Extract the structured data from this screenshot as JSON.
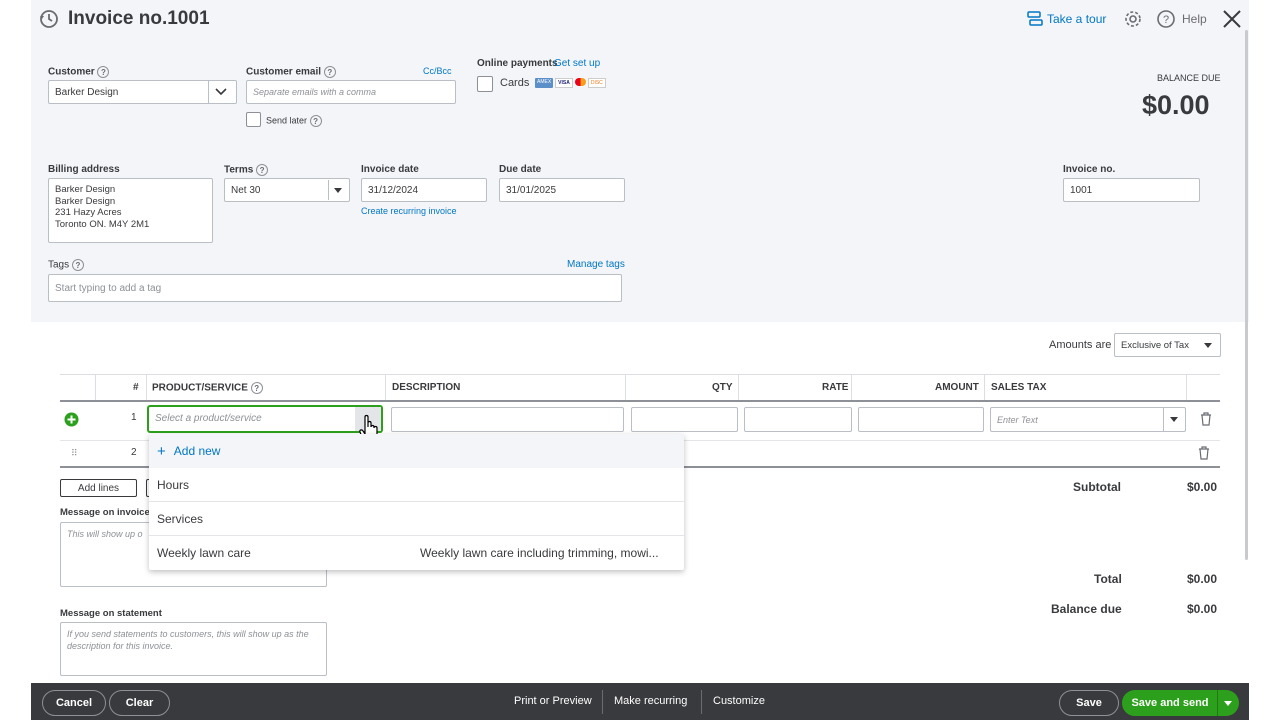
{
  "header": {
    "title": "Invoice no.1001",
    "take_tour": "Take a tour",
    "help": "Help"
  },
  "customer": {
    "label": "Customer",
    "value": "Barker Design",
    "email_label": "Customer email",
    "email_placeholder": "Separate emails with a comma",
    "cc_bcc": "Cc/Bcc",
    "send_later": "Send later"
  },
  "payments": {
    "label": "Online payments",
    "get_setup": "Get set up",
    "cards": "Cards",
    "card_icons": [
      "AMEX",
      "VISA",
      "MC",
      "DISC"
    ]
  },
  "balance": {
    "label": "BALANCE DUE",
    "value": "$0.00"
  },
  "billing": {
    "label": "Billing address",
    "lines": [
      "Barker Design",
      "Barker Design",
      "231 Hazy Acres",
      "Toronto ON.  M4Y 2M1"
    ]
  },
  "terms": {
    "label": "Terms",
    "value": "Net 30"
  },
  "invoice_date": {
    "label": "Invoice date",
    "value": "31/12/2024",
    "recurring_link": "Create recurring invoice"
  },
  "due_date": {
    "label": "Due date",
    "value": "31/01/2025"
  },
  "invoice_no": {
    "label": "Invoice no.",
    "value": "1001"
  },
  "tags": {
    "label": "Tags",
    "manage": "Manage tags",
    "placeholder": "Start typing to add a tag"
  },
  "amounts": {
    "label": "Amounts are",
    "value": "Exclusive of Tax"
  },
  "table": {
    "headers": {
      "num": "#",
      "product": "PRODUCT/SERVICE",
      "description": "DESCRIPTION",
      "qty": "QTY",
      "rate": "RATE",
      "amount": "AMOUNT",
      "tax": "SALES TAX"
    },
    "row1_num": "1",
    "row2_num": "2",
    "product_placeholder": "Select a product/service",
    "tax_placeholder": "Enter Text"
  },
  "dropdown": {
    "add_new": "Add new",
    "items": [
      {
        "name": "Hours",
        "desc": ""
      },
      {
        "name": "Services",
        "desc": ""
      },
      {
        "name": "Weekly lawn care",
        "desc": "Weekly lawn care including trimming, mowi..."
      }
    ]
  },
  "add_lines": "Add lines",
  "message_invoice": {
    "label": "Message on invoice",
    "placeholder": "This will show up o"
  },
  "message_statement": {
    "label": "Message on statement",
    "placeholder": "If you send statements to customers, this will show up as the description for this invoice."
  },
  "totals": {
    "subtotal_label": "Subtotal",
    "subtotal": "$0.00",
    "total_label": "Total",
    "total": "$0.00",
    "balance_label": "Balance due",
    "balance": "$0.00"
  },
  "footer": {
    "cancel": "Cancel",
    "clear": "Clear",
    "print": "Print or Preview",
    "recurring": "Make recurring",
    "customize": "Customize",
    "save": "Save",
    "save_send": "Save and send"
  },
  "colors": {
    "accent_green": "#2ca01c",
    "link_blue": "#0077c5",
    "footer_bg": "#393a3d"
  }
}
